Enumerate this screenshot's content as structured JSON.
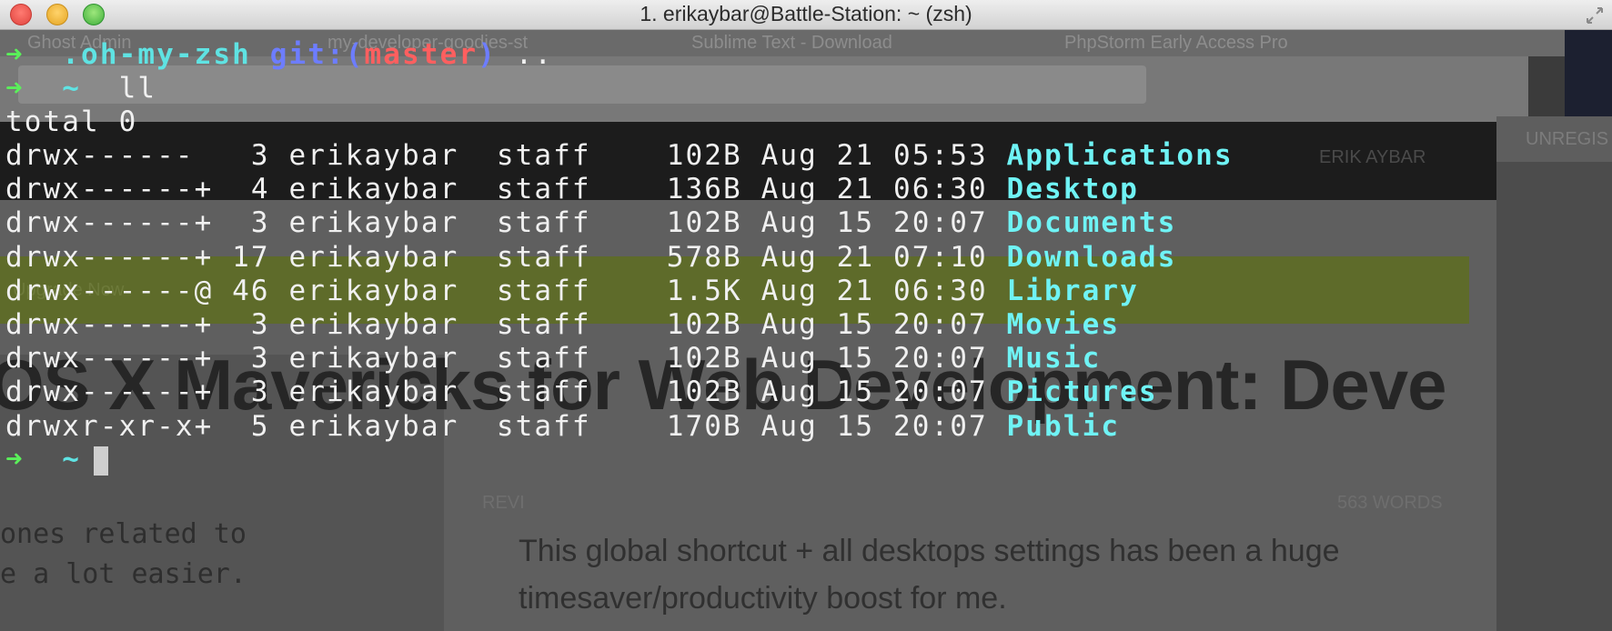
{
  "window": {
    "title": "1. erikaybar@Battle-Station: ~ (zsh)"
  },
  "background": {
    "tabs": [
      "Ghost Admin",
      "my-developer-goodies-st",
      "Sublime Text - Download",
      "PhpStorm Early Access Pro"
    ],
    "username": "ERIK AYBAR",
    "unregistered": "UNREGIS",
    "green_link": "Upgrade Now",
    "headline": "OS X Mavericks for Web Development: Deve",
    "word_count": "563 WORDS",
    "rev_label": "REVI",
    "paragraph": "This global shortcut + all desktops settings has been a huge timesaver/productivity boost for me.",
    "left_text": "ones related to\ne a lot easier."
  },
  "prompt1": {
    "arrow": "➜",
    "dir": ".oh-my-zsh",
    "git_label": "git:(",
    "branch": "master",
    "git_close": ")",
    "command": ".."
  },
  "prompt2": {
    "arrow": "➜",
    "dir": "~",
    "command": "ll"
  },
  "total_line": "total 0",
  "listing": [
    {
      "perms": "drwx------ ",
      "links": " 3",
      "owner": "erikaybar",
      "group": "staff",
      "size": " 102B",
      "date": "Aug 21 05:53",
      "name": "Applications"
    },
    {
      "perms": "drwx------+",
      "links": " 4",
      "owner": "erikaybar",
      "group": "staff",
      "size": " 136B",
      "date": "Aug 21 06:30",
      "name": "Desktop"
    },
    {
      "perms": "drwx------+",
      "links": " 3",
      "owner": "erikaybar",
      "group": "staff",
      "size": " 102B",
      "date": "Aug 15 20:07",
      "name": "Documents"
    },
    {
      "perms": "drwx------+",
      "links": "17",
      "owner": "erikaybar",
      "group": "staff",
      "size": " 578B",
      "date": "Aug 21 07:10",
      "name": "Downloads"
    },
    {
      "perms": "drwx------@",
      "links": "46",
      "owner": "erikaybar",
      "group": "staff",
      "size": " 1.5K",
      "date": "Aug 21 06:30",
      "name": "Library"
    },
    {
      "perms": "drwx------+",
      "links": " 3",
      "owner": "erikaybar",
      "group": "staff",
      "size": " 102B",
      "date": "Aug 15 20:07",
      "name": "Movies"
    },
    {
      "perms": "drwx------+",
      "links": " 3",
      "owner": "erikaybar",
      "group": "staff",
      "size": " 102B",
      "date": "Aug 15 20:07",
      "name": "Music"
    },
    {
      "perms": "drwx------+",
      "links": " 3",
      "owner": "erikaybar",
      "group": "staff",
      "size": " 102B",
      "date": "Aug 15 20:07",
      "name": "Pictures"
    },
    {
      "perms": "drwxr-xr-x+",
      "links": " 5",
      "owner": "erikaybar",
      "group": "staff",
      "size": " 170B",
      "date": "Aug 15 20:07",
      "name": "Public"
    }
  ],
  "prompt3": {
    "arrow": "➜",
    "dir": "~"
  },
  "colors": {
    "arrow": "#5af05a",
    "directory": "#6ff3f5",
    "git": "#6d7dff",
    "branch": "#ff5f5f"
  }
}
